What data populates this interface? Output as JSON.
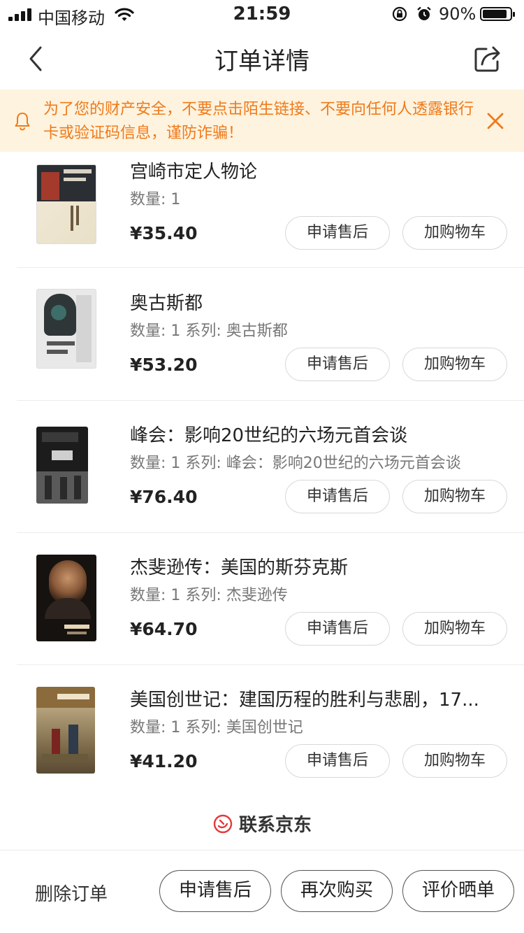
{
  "status": {
    "carrier": "中国移动",
    "time": "21:59",
    "battery_pct": "90%",
    "battery_level": 0.9
  },
  "nav": {
    "title": "订单详情",
    "back_icon": "chevron-left-icon",
    "share_icon": "share-icon"
  },
  "notice": {
    "text": "为了您的财产安全，不要点击陌生链接、不要向任何人透露银行卡或验证码信息，谨防诈骗！",
    "color": "#f07a1a",
    "background": "#fdf3df"
  },
  "items": [
    {
      "title": "宫崎市定人物论",
      "meta": "数量: 1",
      "price": "¥35.40",
      "after_label": "申请售后",
      "cart_label": "加购物车"
    },
    {
      "title": "奥古斯都",
      "meta": "数量: 1 系列: 奥古斯都",
      "price": "¥53.20",
      "after_label": "申请售后",
      "cart_label": "加购物车"
    },
    {
      "title": "峰会：影响20世纪的六场元首会谈",
      "meta": "数量: 1 系列: 峰会：影响20世纪的六场元首会谈",
      "price": "¥76.40",
      "after_label": "申请售后",
      "cart_label": "加购物车"
    },
    {
      "title": "杰斐逊传：美国的斯芬克斯",
      "meta": "数量: 1 系列: 杰斐逊传",
      "price": "¥64.70",
      "after_label": "申请售后",
      "cart_label": "加购物车"
    },
    {
      "title": "美国创世记：建国历程的胜利与悲剧，17...",
      "meta": "数量: 1 系列: 美国创世记",
      "price": "¥41.20",
      "after_label": "申请售后",
      "cart_label": "加购物车"
    }
  ],
  "contact": {
    "label": "联系京东",
    "icon": "jd-service-icon",
    "icon_color": "#e4393c"
  },
  "bottom": {
    "delete_label": "删除订单",
    "after_label": "申请售后",
    "rebuy_label": "再次购买",
    "review_label": "评价晒单"
  }
}
